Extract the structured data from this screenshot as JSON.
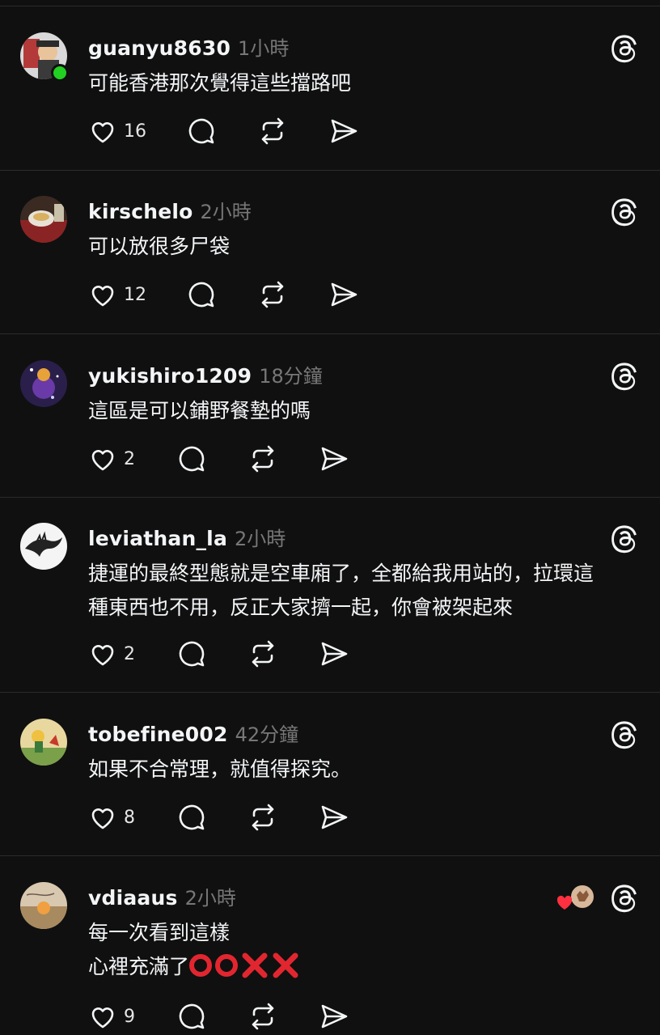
{
  "posts": [
    {
      "username": "guanyu8630",
      "time": "1小時",
      "lines": [
        "可能香港那次覺得這些擋路吧"
      ],
      "likes": "16",
      "online": true
    },
    {
      "username": "kirschelo",
      "time": "2小時",
      "lines": [
        "可以放很多尸袋"
      ],
      "likes": "12"
    },
    {
      "username": "yukishiro1209",
      "time": "18分鐘",
      "lines": [
        "這區是可以鋪野餐墊的嗎"
      ],
      "likes": "2"
    },
    {
      "username": "leviathan_la",
      "time": "2小時",
      "lines": [
        "捷運的最終型態就是空車廂了，全都給我用站的，拉環這",
        "種東西也不用，反正大家擠一起，你會被架起來"
      ],
      "likes": "2"
    },
    {
      "username": "tobefine002",
      "time": "42分鐘",
      "lines": [
        "如果不合常理，就值得探究。"
      ],
      "likes": "8"
    },
    {
      "username": "vdiaaus",
      "time": "2小時",
      "lines": [
        "每一次看到這樣",
        "心裡充滿了"
      ],
      "likes": "9",
      "emoji_suffix": [
        "red-circle",
        "red-circle",
        "red-x",
        "red-x"
      ]
    }
  ],
  "icons": {
    "like": "heart-icon",
    "reply": "comment-icon",
    "repost": "repost-icon",
    "share": "send-icon",
    "threads": "threads-logo-icon"
  },
  "colors": {
    "background": "#101010",
    "text": "#f3f5f7",
    "muted": "#777777",
    "online": "#22d122",
    "emoji_red": "#e2262f"
  }
}
